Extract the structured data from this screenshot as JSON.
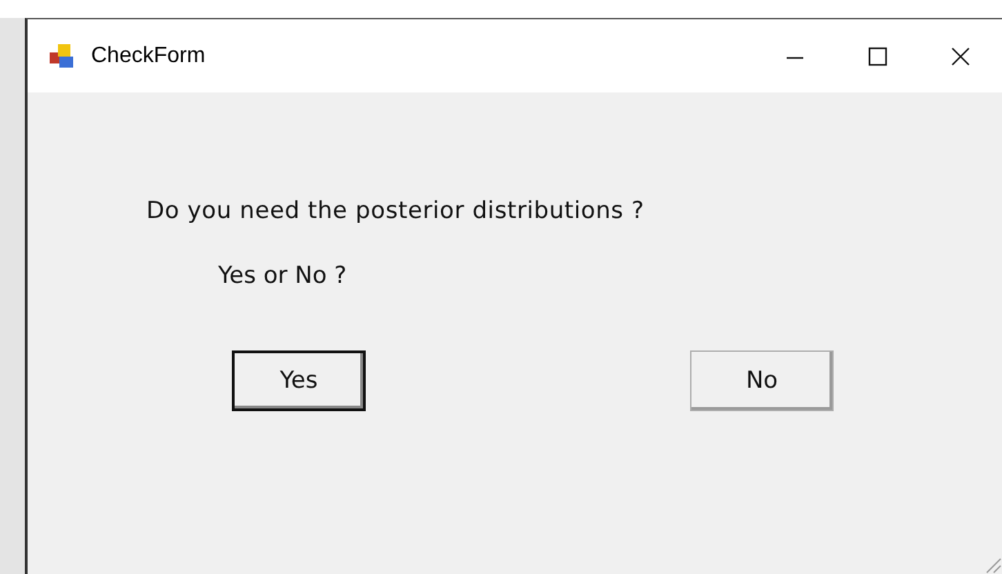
{
  "window": {
    "title": "CheckForm"
  },
  "message": "Do you need the posterior distributions ?",
  "prompt": "Yes or No ?",
  "buttons": [
    {
      "label": "Yes",
      "default": true
    },
    {
      "label": "No",
      "default": false
    }
  ]
}
